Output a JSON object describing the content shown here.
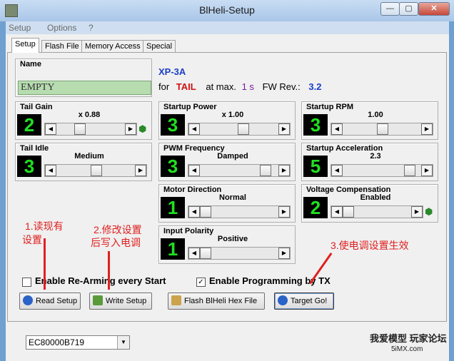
{
  "window": {
    "title": "BlHeli-Setup",
    "min": "—",
    "max": "▢",
    "close": "✕"
  },
  "menu": [
    "Setup",
    "Options",
    "?"
  ],
  "tabs": [
    "Setup",
    "Flash File",
    "Memory Access",
    "Special"
  ],
  "name_group": {
    "label": "Name",
    "value": "EMPTY"
  },
  "esc_info": {
    "model": "XP-3A",
    "for_label": "for",
    "mode": "TAIL",
    "atmax_label": "at max.",
    "atmax_value": "1 s",
    "fw_label": "FW Rev.:",
    "fw_value": "3.2"
  },
  "params": [
    {
      "label": "Tail Gain",
      "value": "x 0.88",
      "digit": "2",
      "level": 0.3
    },
    {
      "label": "Startup Power",
      "value": "x 1.00",
      "digit": "3",
      "level": 0.55
    },
    {
      "label": "Startup RPM",
      "value": "1.00",
      "digit": "3",
      "level": 0.5
    },
    {
      "label": "Tail Idle",
      "value": "Medium",
      "digit": "3",
      "level": 0.5
    },
    {
      "label": "PWM Frequency",
      "value": "Damped",
      "digit": "3",
      "level": 0.88
    },
    {
      "label": "Startup Acceleration",
      "value": "2.3",
      "digit": "5",
      "level": 0.9
    },
    {
      "label": "Motor Direction",
      "value": "Normal",
      "digit": "1",
      "level": 0.0
    },
    {
      "label": "Voltage Compensation",
      "value": "Enabled",
      "digit": "2",
      "level": 0.0
    },
    {
      "label": "Input Polarity",
      "value": "Positive",
      "digit": "1",
      "level": 0.0
    }
  ],
  "options": {
    "rearm_label": "Enable Re-Arming every Start",
    "rearm_checked": false,
    "prog_label": "Enable Programming by TX",
    "prog_checked": true
  },
  "buttons": {
    "read": "Read Setup",
    "write": "Write Setup",
    "flash": "Flash BlHeli Hex File",
    "target": "Target Go!"
  },
  "annotations": {
    "a1_line1": "1.读现有",
    "a1_line2": "设置",
    "a2_line1": "2.修改设置",
    "a2_line2": "后写入电调",
    "a3": "3.使电调设置生效"
  },
  "status": {
    "port": "EC80000B719"
  },
  "watermark": {
    "line1": "我爱模型 玩家论坛",
    "line2": "5iMX.com"
  },
  "colors": {
    "digit_green": "#20e020",
    "accent_blue": "#1a3ec8",
    "mode_red": "#d01010",
    "annotation_red": "#e02020"
  }
}
